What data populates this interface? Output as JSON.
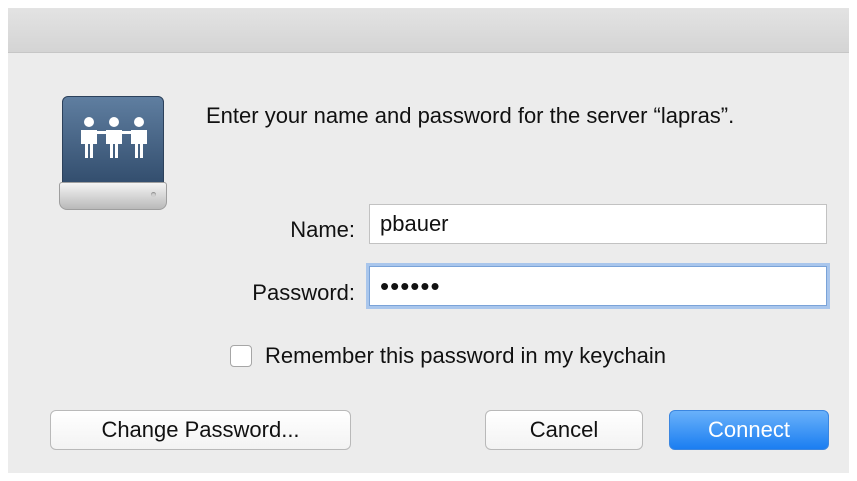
{
  "dialog": {
    "message": "Enter your name and password for the server “lapras”.",
    "icon": "network-server-icon"
  },
  "form": {
    "name_label": "Name:",
    "name_value": "pbauer",
    "password_label": "Password:",
    "password_value": "••••••",
    "remember_label": "Remember this password in my keychain",
    "remember_checked": false
  },
  "buttons": {
    "change_password": "Change Password...",
    "cancel": "Cancel",
    "connect": "Connect"
  },
  "colors": {
    "accent": "#1b7ef1",
    "focus_ring": "#a9c6ec",
    "dialog_bg": "#ececec"
  }
}
